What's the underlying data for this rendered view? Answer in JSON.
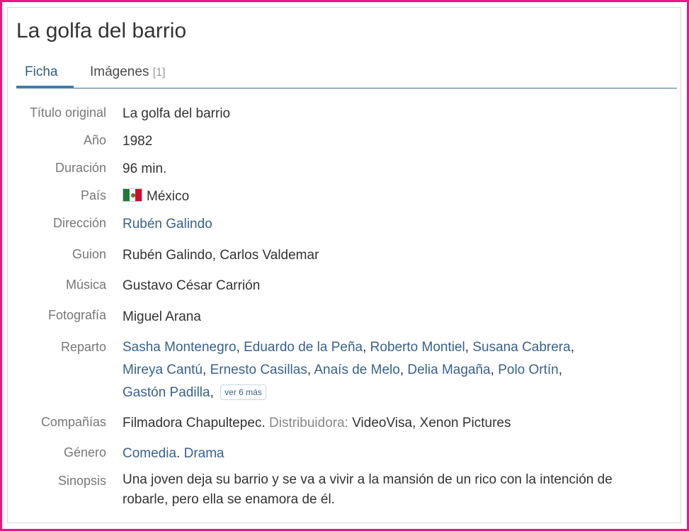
{
  "page": {
    "title": "La golfa del barrio"
  },
  "tabs": [
    {
      "label": "Ficha"
    },
    {
      "label": "Imágenes",
      "count": "[1]"
    }
  ],
  "fields": {
    "titulo_original": {
      "label": "Título original",
      "value": "La golfa del barrio"
    },
    "anio": {
      "label": "Año",
      "value": "1982"
    },
    "duracion": {
      "label": "Duración",
      "value": "96 min."
    },
    "pais": {
      "label": "País",
      "value": "México",
      "flag_icon": "mexico-flag-icon"
    },
    "direccion": {
      "label": "Dirección",
      "value": "Rubén Galindo"
    },
    "guion": {
      "label": "Guion",
      "value": "Rubén Galindo, Carlos Valdemar"
    },
    "musica": {
      "label": "Música",
      "value": "Gustavo César Carrión"
    },
    "fotografia": {
      "label": "Fotografía",
      "value": "Miguel Arana"
    },
    "reparto": {
      "label": "Reparto",
      "actors": [
        "Sasha Montenegro",
        "Eduardo de la Peña",
        "Roberto Montiel",
        "Susana Cabrera",
        "Mireya Cantú",
        "Ernesto Casillas",
        "Anaís de Melo",
        "Delia Magaña",
        "Polo Ortín",
        "Gastón Padilla"
      ],
      "more_label": "ver 6 más"
    },
    "companias": {
      "label": "Compañías",
      "production": "Filmadora Chapultepec.",
      "distrib_label": "Distribuidora:",
      "distrib_value": "VideoVisa, Xenon Pictures"
    },
    "genero": {
      "label": "Género",
      "genre1": "Comedia",
      "genre2": "Drama"
    },
    "sinopsis": {
      "label": "Sinopsis",
      "line1": "Una joven deja su barrio y se va a vivir a la mansión de un rico con la intención de",
      "line2": "robarle, pero ella se enamora de él."
    }
  },
  "colors": {
    "frame": "#e8197f",
    "link": "#38628e",
    "tab_active": "#3e7fae"
  }
}
